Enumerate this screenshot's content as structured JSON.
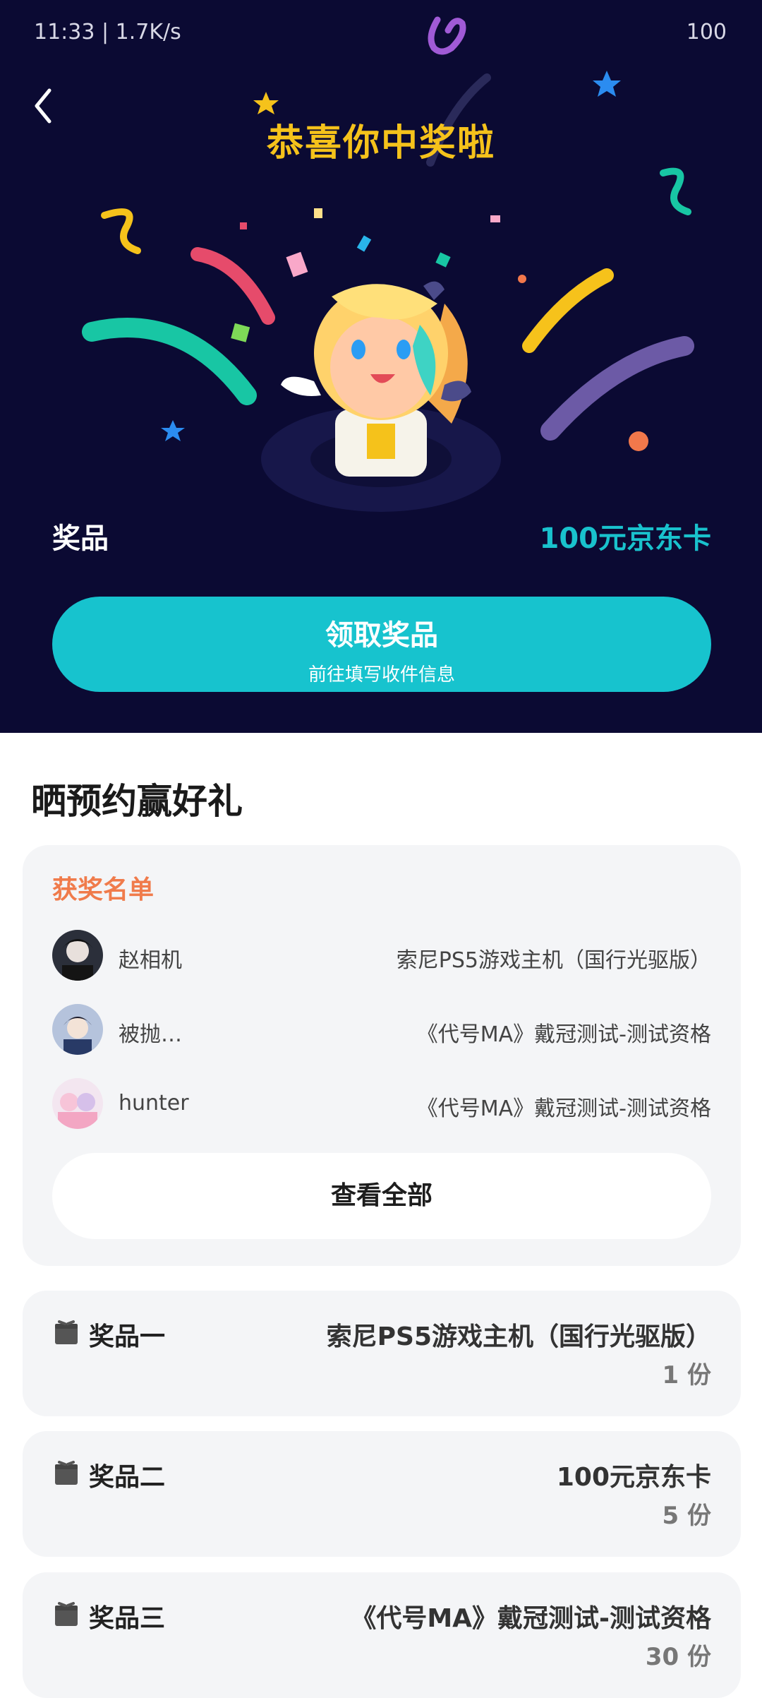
{
  "status_bar": {
    "left_text": "11:33 | 1.7K/s",
    "right_text": "100"
  },
  "hero": {
    "title": "恭喜你中奖啦",
    "prize_label": "奖品",
    "prize_value": "100元京东卡",
    "claim_button": {
      "label": "领取奖品",
      "sublabel": "前往填写收件信息"
    },
    "colors": {
      "background": "#0b0a33",
      "title": "#f5c21b",
      "accent": "#17c3ce"
    }
  },
  "section": {
    "title": "晒预约赢好礼",
    "winners_title": "获奖名单",
    "winners": [
      {
        "name": "赵相机",
        "prize": "索尼PS5游戏主机（国行光驱版）"
      },
      {
        "name": "被抛…",
        "prize": "《代号MA》戴冠测试-测试资格"
      },
      {
        "name": "hunter",
        "prize": "《代号MA》戴冠测试-测试资格"
      }
    ],
    "view_all": "查看全部"
  },
  "prizes": [
    {
      "label": "奖品一",
      "item": "索尼PS5游戏主机（国行光驱版）",
      "qty": "1 份"
    },
    {
      "label": "奖品二",
      "item": "100元京东卡",
      "qty": "5 份"
    },
    {
      "label": "奖品三",
      "item": "《代号MA》戴冠测试-测试资格",
      "qty": "30 份"
    }
  ]
}
